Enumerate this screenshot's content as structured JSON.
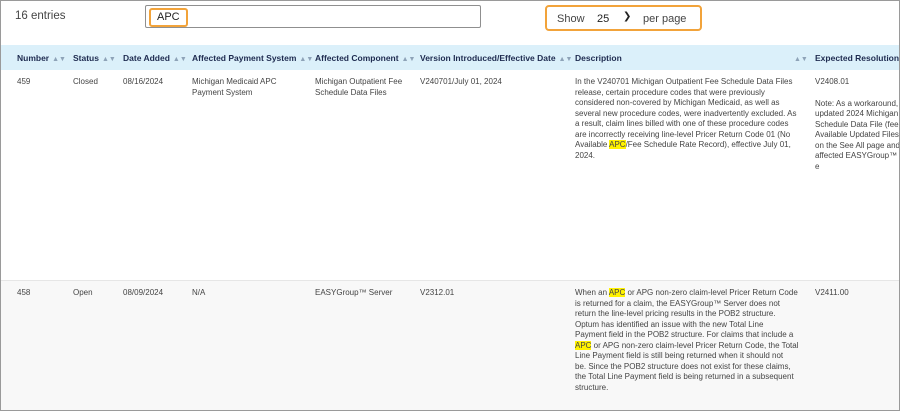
{
  "toolbar": {
    "entries_text": "16 entries",
    "search_value": "APC",
    "length_show": "Show",
    "length_value": "25",
    "length_per_page": "per page",
    "chevron_icon": "chevron-down-icon"
  },
  "table": {
    "columns": [
      "Number",
      "Status",
      "Date Added",
      "Affected Payment System",
      "Affected Component",
      "Version Introduced/Effective Date",
      "Description",
      "Expected Resolution Ti"
    ],
    "rows": [
      {
        "number": "459",
        "status": "Closed",
        "date_added": "08/16/2024",
        "payment_system_l1": "Michigan Medicaid APC",
        "payment_system_l2": "Payment System",
        "component_l1": "Michigan Outpatient Fee",
        "component_l2": "Schedule Data Files",
        "version": "V240701/July 01, 2024",
        "desc": {
          "l1": "In the V240701 Michigan Outpatient Fee Schedule Data Files",
          "l2": "release, certain procedure codes that were previously",
          "l3": "considered non-covered by Michigan Medicaid, as well as",
          "l4": "several new procedure codes, were inadvertently excluded. As",
          "l5": "a result, claim lines billed with one of these procedure codes",
          "l6": "are incorrectly receiving line-level Pricer Return Code 01 (No",
          "l7_pre": "Available ",
          "l7_hl": "APC",
          "l7_post": "/Fee Schedule Rate Record), effective July 01,",
          "l8": "2024."
        },
        "resolution": {
          "l1": "V2408.01",
          "l2": "Note: As a workaround,",
          "l3": "updated 2024 Michigan",
          "l4": "Schedule Data File (fee",
          "l5": "Available Updated Files",
          "l6": "on the See All page and",
          "l7": "affected EASYGroup™ e"
        }
      },
      {
        "number": "458",
        "status": "Open",
        "date_added": "08/09/2024",
        "payment_system_l1": "N/A",
        "component_l1": "EASYGroup™ Server",
        "version": "V2312.01",
        "desc": {
          "l1_pre": "When an ",
          "l1_hl": "APC",
          "l1_post": " or APG non-zero claim-level Pricer Return Code",
          "l2": "is returned for a claim, the EASYGroup™ Server does not",
          "l3": "return the line-level pricing results in the POB2 structure.",
          "l4": "Optum has identified an issue with the new Total Line",
          "l5": "Payment field in the POB2 structure. For claims that include a",
          "l6_hl": "APC",
          "l6_post": " or APG non-zero claim-level Pricer Return Code, the Total",
          "l7": "Line Payment field is still being returned when it should not",
          "l8": "be. Since the POB2 structure does not exist for these claims,",
          "l9": "the Total Line Payment field is being returned in a subsequent",
          "l10": "structure."
        },
        "resolution": {
          "l1": "V2411.00"
        }
      }
    ]
  },
  "sort_icon": "↕"
}
